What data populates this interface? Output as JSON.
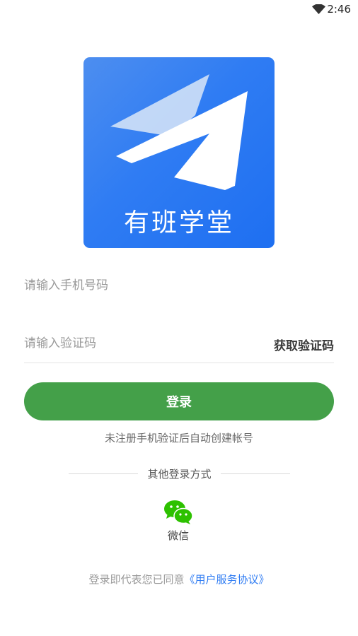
{
  "status_bar": {
    "time": "2:46",
    "wifi_icon": "wifi-icon"
  },
  "logo": {
    "text": "有班学堂",
    "icon": "paper-plane-icon"
  },
  "phone_field": {
    "placeholder": "请输入手机号码",
    "value": ""
  },
  "code_field": {
    "placeholder": "请输入验证码",
    "value": "",
    "get_code_label": "获取验证码"
  },
  "login_button": {
    "label": "登录",
    "color": "#44a049"
  },
  "notice": "未注册手机验证后自动创建帐号",
  "other_login": {
    "title": "其他登录方式",
    "options": [
      {
        "label": "微信",
        "icon": "wechat-icon",
        "color": "#2dc100"
      }
    ]
  },
  "agreement": {
    "prefix": "登录即代表您已同意",
    "link": "《用户服务协议》",
    "link_color": "#2f7cf3"
  }
}
